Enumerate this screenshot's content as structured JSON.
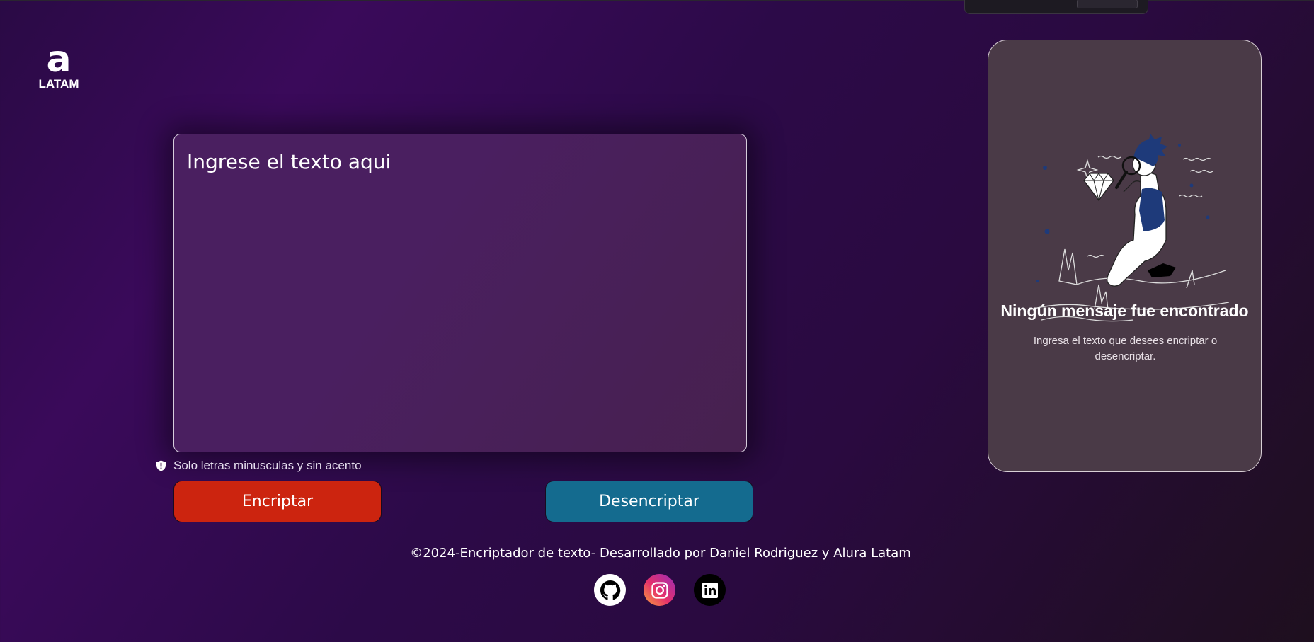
{
  "logo": {
    "mark": "a",
    "word": "LATAM"
  },
  "input": {
    "placeholder": "Ingrese el texto aqui",
    "value": ""
  },
  "hint": {
    "text": "Solo letras minusculas y sin acento"
  },
  "buttons": {
    "encrypt": "Encriptar",
    "decrypt": "Desencriptar"
  },
  "footer": {
    "text": "©2024-Encriptador de texto- Desarrollado por Daniel Rodriguez y Alura Latam"
  },
  "social": [
    {
      "icon": "github-icon"
    },
    {
      "icon": "instagram-icon"
    },
    {
      "icon": "linkedin-icon"
    }
  ],
  "result_panel": {
    "title": "Ningún mensaje fue encontrado",
    "subtitle": "Ingresa el texto que desees encriptar o desencriptar."
  },
  "colors": {
    "encrypt_button": "#cc240f",
    "decrypt_button": "#146b8f",
    "panel_bg": "#4a3a47",
    "input_bg": "#4a1f60"
  }
}
